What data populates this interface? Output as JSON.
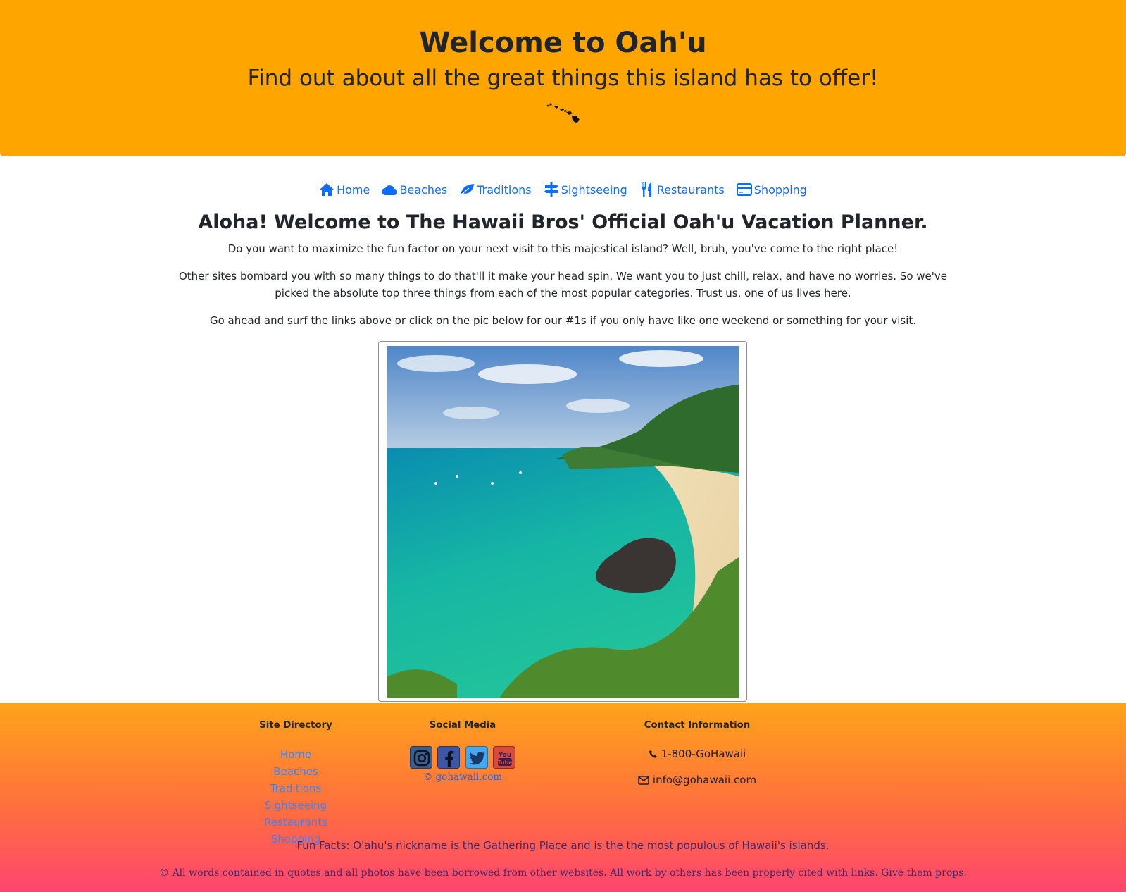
{
  "header": {
    "title": "Welcome to Oah'u",
    "subtitle": "Find out about all the great things this island has to offer!",
    "icon": "hawaii-islands-icon"
  },
  "nav": {
    "items": [
      {
        "label": "Home",
        "icon": "home-icon"
      },
      {
        "label": "Beaches",
        "icon": "cloud-icon"
      },
      {
        "label": "Traditions",
        "icon": "leaf-icon"
      },
      {
        "label": "Sightseeing",
        "icon": "signpost-icon"
      },
      {
        "label": "Restaurants",
        "icon": "utensils-icon"
      },
      {
        "label": "Shopping",
        "icon": "credit-card-icon"
      }
    ]
  },
  "main": {
    "heading": "Aloha! Welcome to The Hawaii Bros' Official Oah'u Vacation Planner.",
    "paragraphs": [
      "Do you want to maximize the fun factor on your next visit to this majestical island? Well, bruh, you've come to the right place!",
      "Other sites bombard you with so many things to do that'll it make your head spin. We want you to just chill, relax, and have no worries. So we've picked the absolute top three things from each of the most popular categories. Trust us, one of us lives here.",
      "Go ahead and surf the links above or click on the pic below for our #1s if you only have like one weekend or something for your visit."
    ],
    "image": "beach-bay-photo"
  },
  "footer": {
    "directory": {
      "heading": "Site Directory",
      "links": [
        "Home",
        "Beaches",
        "Traditions",
        "Sightseeing",
        "Restaurants",
        "Shopping"
      ]
    },
    "social": {
      "heading": "Social Media",
      "icons": [
        "instagram-icon",
        "facebook-icon",
        "twitter-icon",
        "youtube-icon"
      ],
      "copyright": "© gohawaii.com"
    },
    "contact": {
      "heading": "Contact Information",
      "phone": "1-800-GoHawaii",
      "email": "info@gohawaii.com"
    },
    "fun_fact": "Fun Facts: O'ahu's nickname is the Gathering Place and is the the most populous of Hawaii's islands.",
    "credits": "© All words contained in quotes and all photos have been borrowed from other websites. All work by others has been properly cited with links. Give them props."
  },
  "colors": {
    "header_bg": "#ffa500",
    "link": "#0d6efd",
    "footer_gradient_top": "#ffa41a",
    "footer_gradient_bottom": "#ff4570"
  }
}
